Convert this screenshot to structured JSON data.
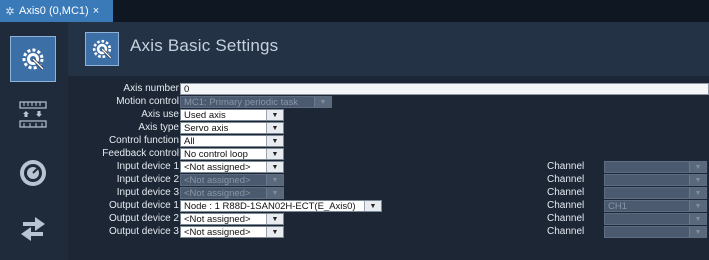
{
  "tab": {
    "title": "Axis0 (0,MC1)",
    "close": "×",
    "icon": "gear-icon"
  },
  "header": {
    "title": "Axis Basic Settings",
    "icon": "axis-gear-icon"
  },
  "sidebar": [
    {
      "name": "axis-basic-settings",
      "icon": "gear-icon",
      "active": true
    },
    {
      "name": "unit-conversion",
      "icon": "ruler-arrows-icon",
      "active": false
    },
    {
      "name": "operation-settings",
      "icon": "dial-icon",
      "active": false
    },
    {
      "name": "other-operation-settings",
      "icon": "swap-arrows-icon",
      "active": false
    }
  ],
  "fields": {
    "axis_number": {
      "label": "Axis number",
      "value": "0"
    },
    "motion_control": {
      "label": "Motion control",
      "value": "MC1: Primary periodic task"
    },
    "axis_use": {
      "label": "Axis use",
      "value": "Used axis"
    },
    "axis_type": {
      "label": "Axis type",
      "value": "Servo axis"
    },
    "control_function": {
      "label": "Control function",
      "value": "All"
    },
    "feedback_control": {
      "label": "Feedback control",
      "value": "No control loop"
    },
    "input_device_1": {
      "label": "Input device 1",
      "value": "<Not assigned>"
    },
    "input_device_2": {
      "label": "Input device 2",
      "value": "<Not assigned>"
    },
    "input_device_3": {
      "label": "Input device 3",
      "value": "<Not assigned>"
    },
    "output_device_1": {
      "label": "Output device 1",
      "value": "Node : 1 R88D-1SAN02H-ECT(E_Axis0)"
    },
    "output_device_2": {
      "label": "Output device 2",
      "value": "<Not assigned>"
    },
    "output_device_3": {
      "label": "Output device 3",
      "value": "<Not assigned>"
    }
  },
  "channel": {
    "label": "Channel",
    "values": [
      "",
      "",
      "",
      "CH1",
      "",
      ""
    ]
  },
  "colors": {
    "accent": "#3c6fa6",
    "tab": "#3a7ab8",
    "panel": "#1c2635"
  }
}
